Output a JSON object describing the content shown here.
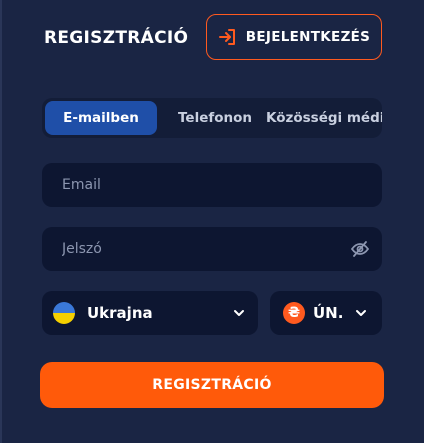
{
  "header": {
    "title": "REGISZTRÁCIÓ",
    "login_label": "BEJELENTKEZÉS",
    "login_icon": "login-arrow-icon"
  },
  "tabs": [
    {
      "label": "E-mailben",
      "active": true
    },
    {
      "label": "Telefonon",
      "active": false
    },
    {
      "label": "Közösségi médi",
      "active": false
    }
  ],
  "form": {
    "email_placeholder": "Email",
    "password_placeholder": "Jelszó",
    "password_icon": "eye-off-icon",
    "country_value": "Ukrajna",
    "currency_value": "ÚN.",
    "currency_symbol": "₴",
    "submit_label": "REGISZTRÁCIÓ"
  },
  "colors": {
    "background": "#1a2544",
    "field": "#0d1631",
    "accent": "#ff5a0a",
    "active_tab": "#1f4fa8"
  }
}
